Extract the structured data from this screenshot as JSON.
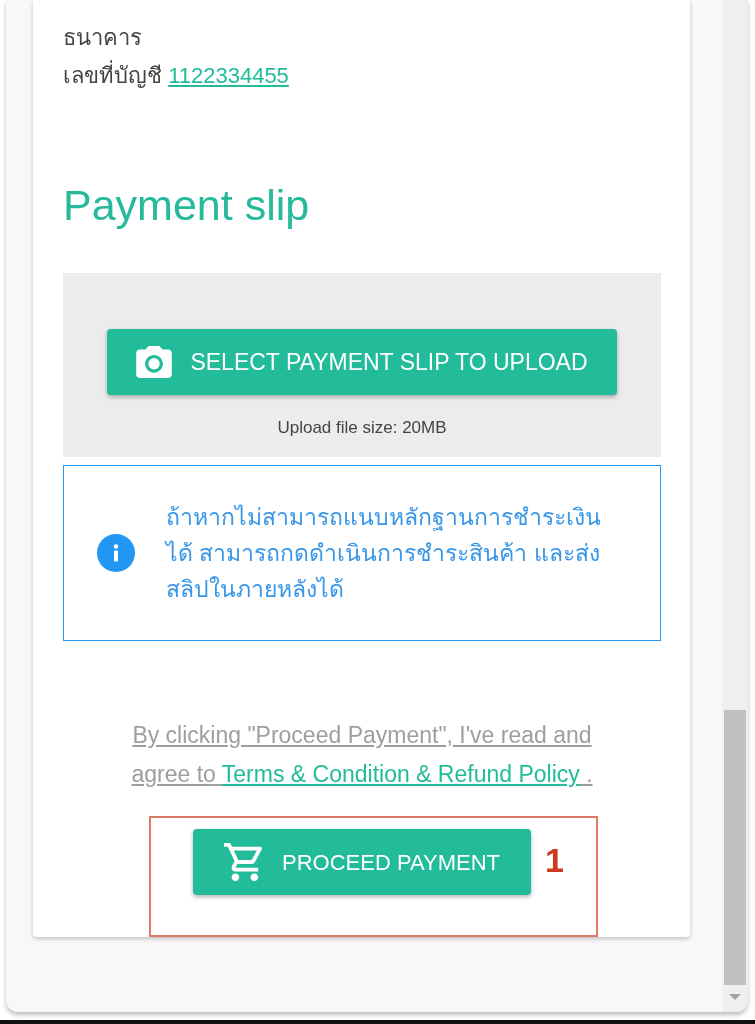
{
  "bank_details": {
    "bank_label": "ธนาคาร",
    "account_label": "เลขที่บัญชี",
    "account_number": "1122334455"
  },
  "payment_slip": {
    "heading": "Payment slip",
    "upload_button": "SELECT PAYMENT SLIP TO UPLOAD",
    "file_size_note": "Upload file size: 20MB"
  },
  "info_notice": {
    "text": "ถ้าหากไม่สามารถแนบหลักฐานการชำระเงินได้ สามารถกดดำเนินการชำระสินค้า และส่งสลิปในภายหลังได้"
  },
  "terms": {
    "text_before": "By clicking \"Proceed Payment\", I've read and agree to",
    "link": "Terms & Condition & Refund Policy",
    "text_after": " ."
  },
  "proceed_button": "PROCEED PAYMENT",
  "annotation": {
    "label": "1"
  }
}
